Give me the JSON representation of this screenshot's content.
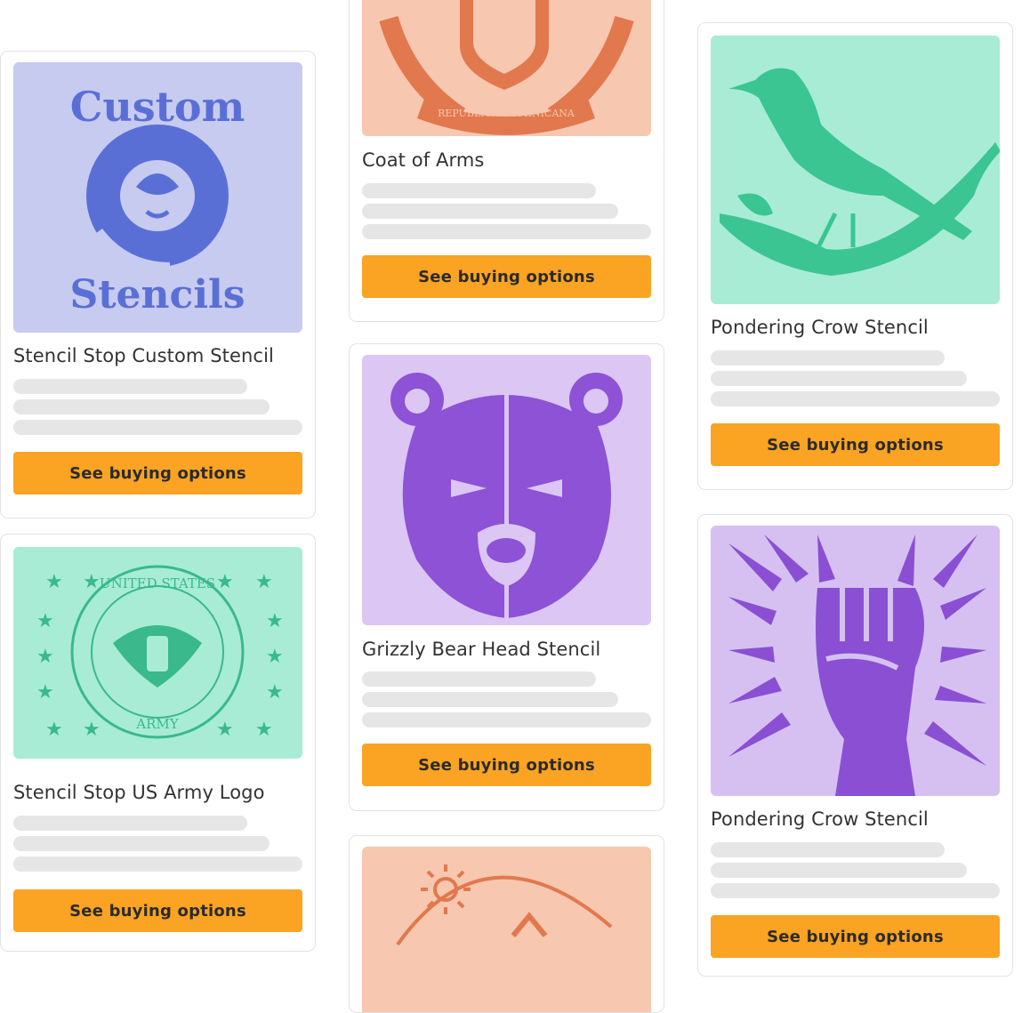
{
  "products": [
    {
      "title": "Stencil Stop Custom Stencil",
      "button": "See buying options",
      "image": "custom-stencils-sloth",
      "image_text_top": "Custom",
      "image_text_bottom": "Stencils",
      "bg": "#c7cbf0",
      "fg": "#5a6fd6"
    },
    {
      "title": "Stencil Stop US Army Logo",
      "button": "See buying options",
      "image": "us-army-seal",
      "image_text_top": "UNITED STATES",
      "image_text_bottom": "ARMY",
      "bg": "#a8ecd6",
      "fg": "#39b98c"
    },
    {
      "title": "Coat of Arms",
      "button": "See buying options",
      "image": "coat-of-arms-dominican",
      "image_text": "REPUBLICA DOMINICANA",
      "bg": "#f7c7b0",
      "fg": "#e2784d"
    },
    {
      "title": "Grizzly Bear Head Stencil",
      "button": "See buying options",
      "image": "grizzly-bear-head",
      "bg": "#dcc6f3",
      "fg": "#8d52d6"
    },
    {
      "title": "",
      "button": "",
      "image": "sun-mountain",
      "bg": "#f7c7b0",
      "fg": "#e2784d"
    },
    {
      "title": "Pondering Crow Stencil",
      "button": "See buying options",
      "image": "crow-on-branch",
      "bg": "#a8ecd6",
      "fg": "#3bc593"
    },
    {
      "title": "Pondering Crow Stencil",
      "button": "See buying options",
      "image": "raised-fist",
      "bg": "#d6c0f1",
      "fg": "#8a4fd3"
    }
  ],
  "colors": {
    "button": "#fba323",
    "skeleton": "#e6e6e6"
  }
}
